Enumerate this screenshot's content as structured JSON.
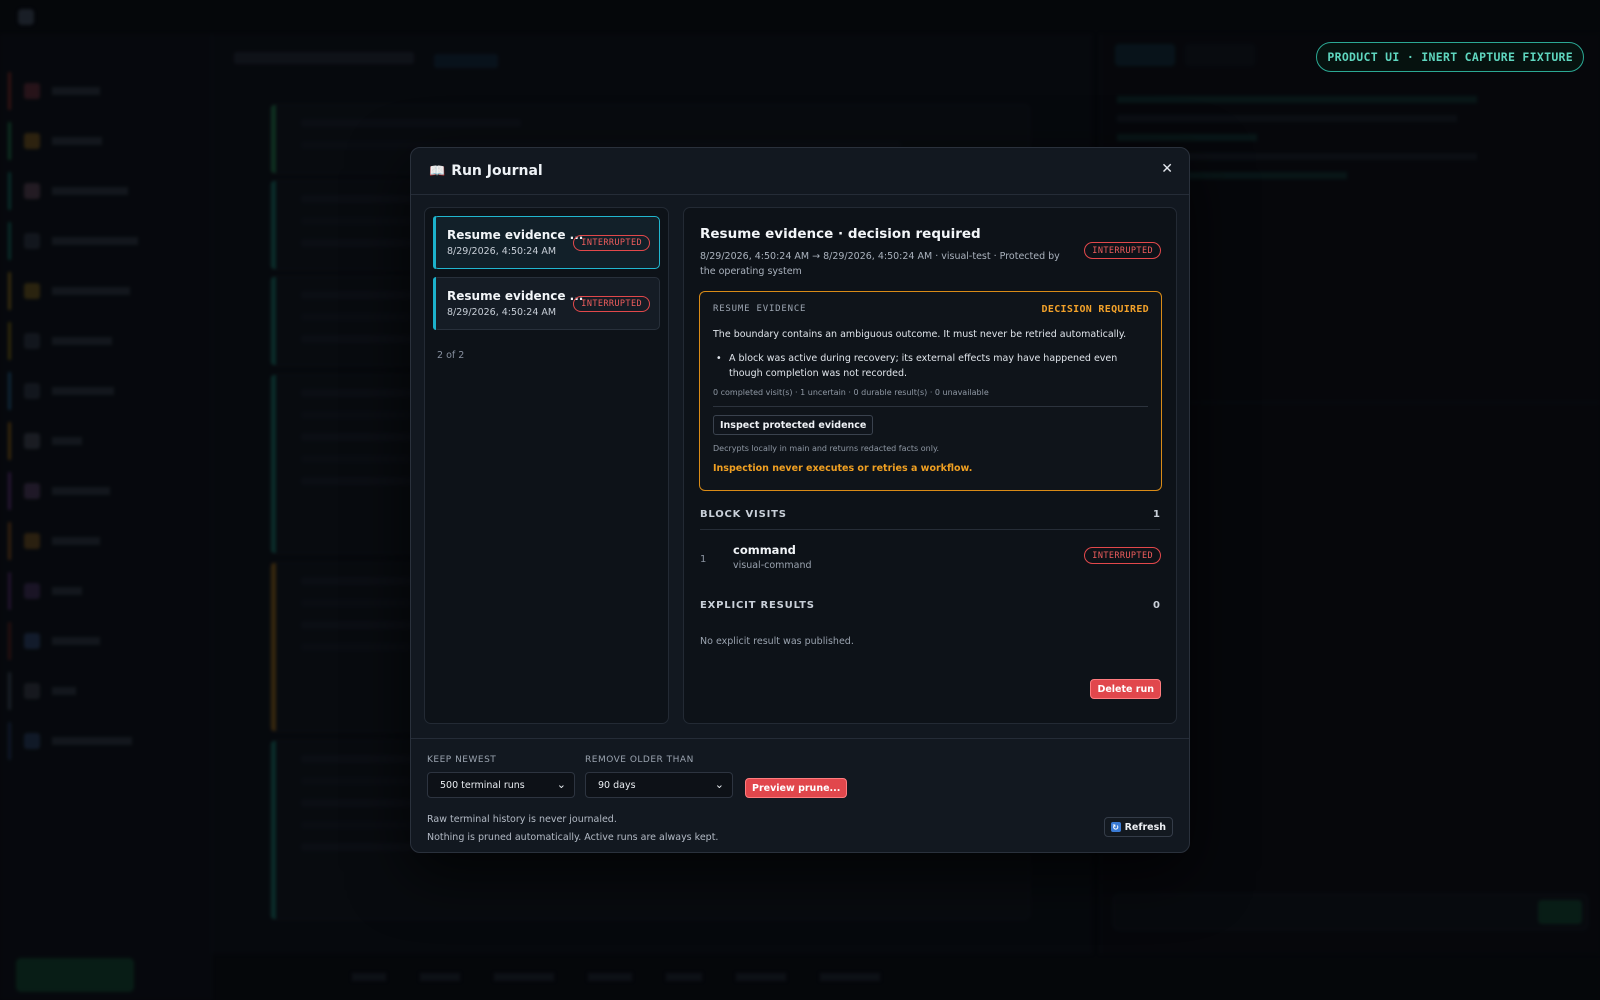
{
  "fixture_label": "PRODUCT UI · INERT CAPTURE FIXTURE",
  "modal": {
    "title": "Run Journal",
    "close_glyph": "✕",
    "runs": [
      {
        "name": "Resume evidence ...",
        "timestamp": "8/29/2026, 4:50:24 AM",
        "status": "INTERRUPTED",
        "selected": true
      },
      {
        "name": "Resume evidence ...",
        "timestamp": "8/29/2026, 4:50:24 AM",
        "status": "INTERRUPTED",
        "selected": false
      }
    ],
    "pager": "2 of 2",
    "detail": {
      "title": "Resume evidence · decision required",
      "meta": "8/29/2026, 4:50:24 AM → 8/29/2026, 4:50:24 AM · visual-test · Protected by the operating system",
      "status": "INTERRUPTED",
      "evidence": {
        "label": "RESUME EVIDENCE",
        "decision": "DECISION REQUIRED",
        "description": "The boundary contains an ambiguous outcome. It must never be retried automatically.",
        "bullet": "A block was active during recovery; its external effects may have happened even though completion was not recorded.",
        "counts": "0 completed visit(s) · 1 uncertain · 0 durable result(s) · 0 unavailable",
        "inspect_button": "Inspect protected evidence",
        "decrypt_note": "Decrypts locally in main and returns redacted facts only.",
        "warning": "Inspection never executes or retries a workflow."
      },
      "block_visits": {
        "heading": "BLOCK VISITS",
        "count": "1",
        "items": [
          {
            "index": "1",
            "name": "command",
            "sub": "visual-command",
            "status": "INTERRUPTED"
          }
        ]
      },
      "explicit_results": {
        "heading": "EXPLICIT RESULTS",
        "count": "0",
        "empty_text": "No explicit result was published."
      },
      "delete_button": "Delete run"
    },
    "footer": {
      "keep_label": "KEEP NEWEST",
      "keep_value": "500 terminal runs",
      "remove_label": "REMOVE OLDER THAN",
      "remove_value": "90 days",
      "preview_button": "Preview prune...",
      "note1": "Raw terminal history is never journaled.",
      "note2": "Nothing is pruned automatically. Active runs are always kept.",
      "refresh_button": "Refresh"
    }
  },
  "colors": {
    "accent_cyan": "#21b6cf",
    "status_red": "#ef5d5d",
    "warning_orange": "#f3a22a",
    "danger_button": "#e1474c",
    "fixture_teal": "#5fd6bf"
  },
  "icons": {
    "modal_title_icon": "book-icon",
    "close": "close-icon",
    "select_chevron": "chevron-down-icon",
    "refresh": "refresh-icon"
  }
}
